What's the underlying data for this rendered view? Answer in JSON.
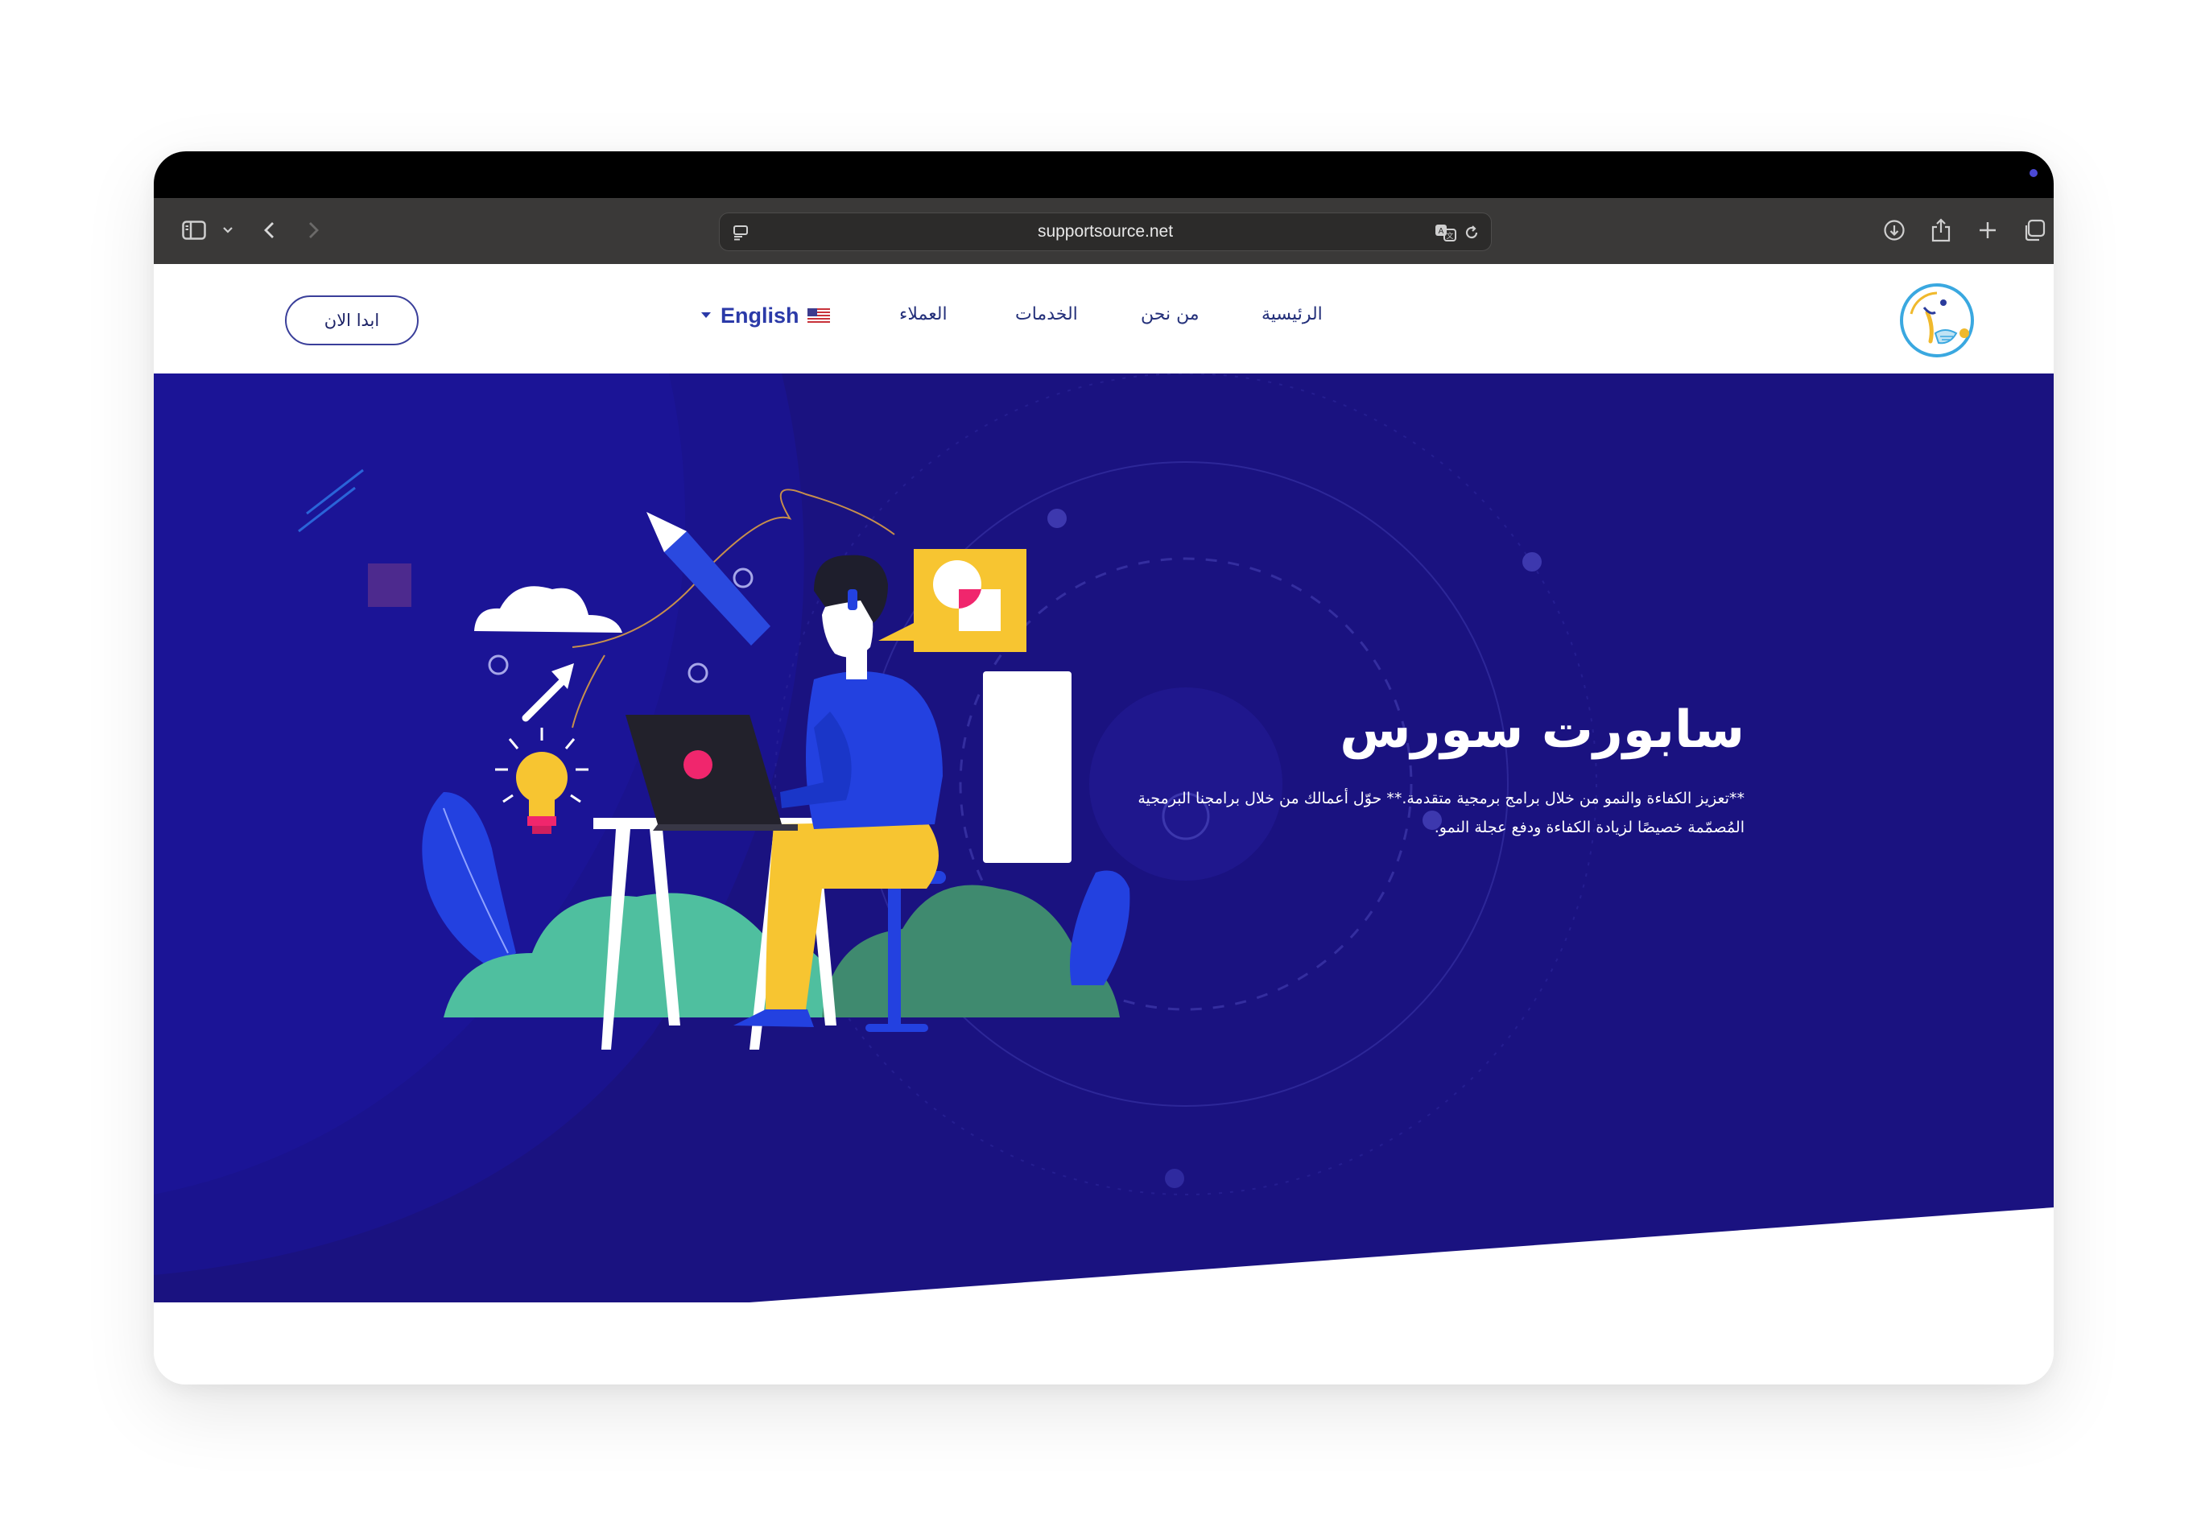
{
  "browser": {
    "url": "supportsource.net"
  },
  "nav": {
    "links": [
      "الرئيسية",
      "من نحن",
      "الخدمات",
      "العملاء"
    ],
    "language": "English",
    "cta_label": "ابدا الان"
  },
  "hero": {
    "title": "سابورت سورس",
    "description": "**تعزيز الكفاءة والنمو من خلال برامج برمجية متقدمة.** حوّل أعمالك من خلال برامجنا البرمجية المُصمّمة خصيصًا لزيادة الكفاءة ودفع عجلة النمو."
  },
  "colors": {
    "hero_bg": "#19127a",
    "accent_yellow": "#f7c531",
    "accent_blue": "#2341e0",
    "accent_green": "#4fbf9f",
    "accent_pink": "#f0266d",
    "nav_text": "#24307a"
  }
}
